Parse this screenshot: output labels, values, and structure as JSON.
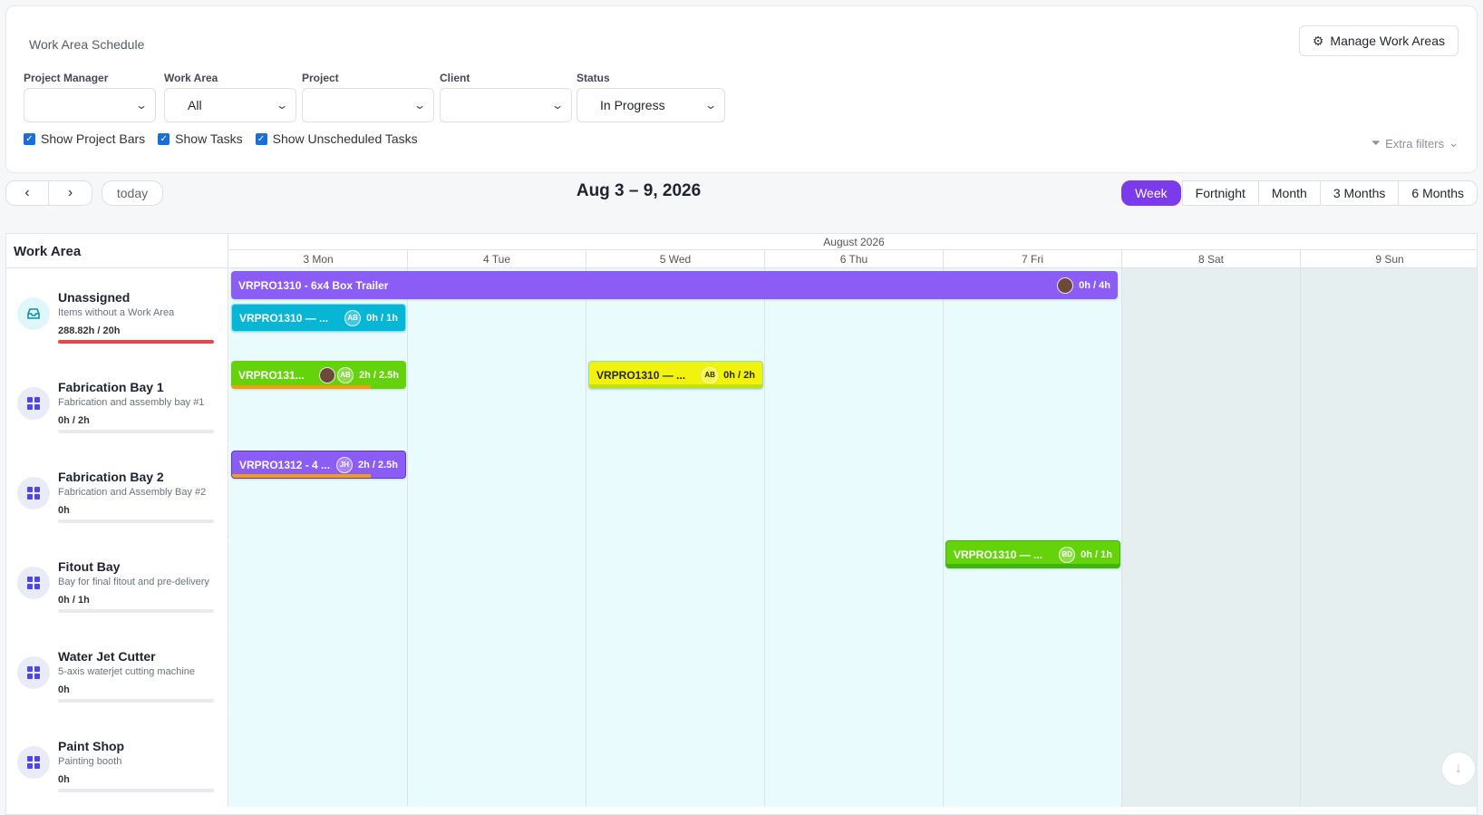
{
  "header": {
    "title": "Work Area Schedule",
    "manage_label": "Manage Work Areas"
  },
  "filters": {
    "project_manager": {
      "label": "Project Manager",
      "value": ""
    },
    "work_area": {
      "label": "Work Area",
      "value": "All"
    },
    "project": {
      "label": "Project",
      "value": ""
    },
    "client": {
      "label": "Client",
      "value": ""
    },
    "status": {
      "label": "Status",
      "value": "In Progress"
    }
  },
  "checkboxes": {
    "project_bars": "Show Project Bars",
    "tasks": "Show Tasks",
    "unscheduled": "Show Unscheduled Tasks"
  },
  "extra_filters": "Extra filters",
  "toolbar": {
    "prev": "‹",
    "next": "›",
    "today": "today",
    "range": "Aug 3 – 9, 2026"
  },
  "views": [
    "Week",
    "Fortnight",
    "Month",
    "3 Months",
    "6 Months"
  ],
  "active_view": "Week",
  "grid": {
    "wa_header": "Work Area",
    "month": "August 2026",
    "days": [
      "3 Mon",
      "4 Tue",
      "5 Wed",
      "6 Thu",
      "7 Fri",
      "8 Sat",
      "9 Sun"
    ]
  },
  "work_areas": [
    {
      "name": "Unassigned",
      "desc": "Items without a Work Area",
      "hours": "288.82h / 20h",
      "load": 1.0
    },
    {
      "name": "Fabrication Bay 1",
      "desc": "Fabrication and assembly bay #1",
      "hours": "0h / 2h",
      "load": 0
    },
    {
      "name": "Fabrication Bay 2",
      "desc": "Fabrication and Assembly Bay #2",
      "hours": "0h",
      "load": 0
    },
    {
      "name": "Fitout Bay",
      "desc": "Bay for final fitout and pre-delivery",
      "hours": "0h / 1h",
      "load": 0
    },
    {
      "name": "Water Jet Cutter",
      "desc": "5-axis waterjet cutting machine",
      "hours": "0h",
      "load": 0
    },
    {
      "name": "Paint Shop",
      "desc": "Painting booth",
      "hours": "0h",
      "load": 0
    }
  ],
  "events": {
    "project_bar": {
      "title": "VRPRO1310 - 6x4 Box Trailer",
      "hours": "0h / 4h"
    },
    "unassigned_task": {
      "title": "VRPRO1310 — ...",
      "avatar": "AB",
      "hours": "0h / 1h"
    },
    "fab1_task_a": {
      "title": "VRPRO131...",
      "avatar": "AB",
      "hours": "2h / 2.5h"
    },
    "fab1_task_b": {
      "title": "VRPRO1310 — ...",
      "avatar": "AB",
      "hours": "0h / 2h"
    },
    "fab2_task": {
      "title": "VRPRO1312 - 4 ...",
      "avatar": "JH",
      "hours": "2h / 2.5h"
    },
    "fitout_task": {
      "title": "VRPRO1310 — ...",
      "avatar": "BD",
      "hours": "0h / 1h"
    }
  },
  "colors": {
    "accent": "#7c3aed",
    "purple_bar": "#8b5cf6",
    "cyan_bar": "#06b6d4",
    "green_bar": "#65d30b",
    "yellow_bar": "#f2f20f",
    "overload": "#ef4444"
  }
}
